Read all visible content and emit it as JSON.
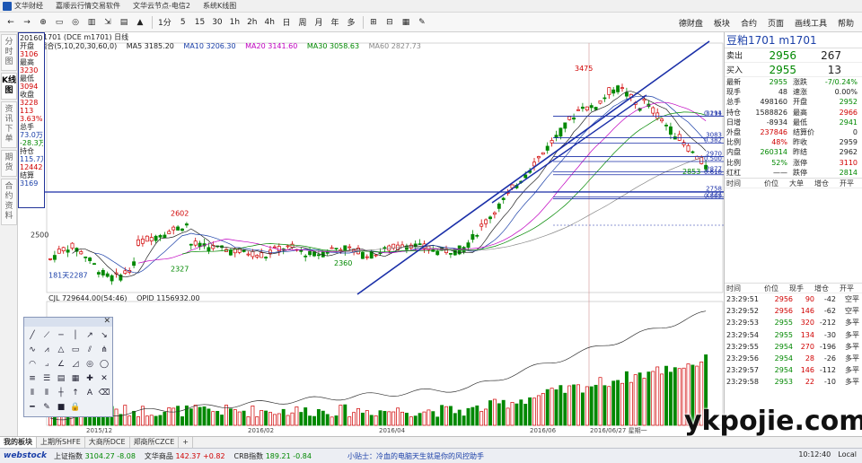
{
  "titlebar": {
    "items": [
      "文华财经",
      "嘉顺云行情交易软件",
      "文华云节点-电信2",
      "系统K线图"
    ],
    "right": [
      "德财盘",
      "板块",
      "合约",
      "页面",
      "画线工具",
      "帮助"
    ]
  },
  "toolbar": {
    "buttons": [
      "←",
      "→",
      "⊕",
      "▭",
      "◎",
      "▥",
      "⇲",
      "▤",
      "▲",
      "1分",
      "5",
      "15",
      "30",
      "1h",
      "2h",
      "4h",
      "日",
      "周",
      "月",
      "年",
      "多",
      "⊞",
      "⊟",
      "▦",
      "✎"
    ],
    "right_buttons": [
      "德财盘",
      "板块",
      "合约",
      "页面",
      "画线工具",
      "帮助"
    ]
  },
  "left_tabs": [
    "分时图",
    "K线图",
    "资讯下单",
    "期货",
    "合约资料"
  ],
  "data_window": {
    "date": "20160627",
    "rows": [
      {
        "label": "开盘",
        "value": "3106",
        "cls": "up"
      },
      {
        "label": "最高",
        "value": "3230",
        "cls": "up"
      },
      {
        "label": "最低",
        "value": "3094",
        "cls": "up"
      },
      {
        "label": "收盘",
        "value": "3228",
        "cls": "up"
      },
      {
        "label": "",
        "value": "113",
        "cls": "up"
      },
      {
        "label": "",
        "value": "3.63%",
        "cls": "up"
      },
      {
        "label": "总手",
        "value": "73.0万",
        "cls": "bl"
      },
      {
        "label": "",
        "value": "-28.3万",
        "cls": "dn"
      },
      {
        "label": "持仓",
        "value": "115.7万",
        "cls": "bl"
      },
      {
        "label": "",
        "value": "12442",
        "cls": "up"
      },
      {
        "label": "结算",
        "value": "3169",
        "cls": "bl"
      }
    ]
  },
  "chart_head": "豆粕1701 (DCE m1701) 日线",
  "ma_legend": [
    {
      "text": "MA组合(5,10,20,30,60,0)",
      "color": "#222222"
    },
    {
      "text": "MA5 3185.20",
      "color": "#222222"
    },
    {
      "text": "MA10 3206.30",
      "color": "#1a3fa8"
    },
    {
      "text": "MA20 3141.60",
      "color": "#c000c0"
    },
    {
      "text": "MA30 3058.63",
      "color": "#008800"
    },
    {
      "text": "MA60 2827.73",
      "color": "#888888"
    }
  ],
  "vol_legend": [
    "CJL 729644.00(54:46)",
    "OPID 1156932.00"
  ],
  "chart_data": {
    "type": "candlestick",
    "dates": [
      "2015/12",
      "2016/02",
      "2016/04",
      "2016/06",
      "2016/06/27 星期一"
    ],
    "price_ylim": [
      2150,
      3600
    ],
    "price_ticks": [
      2500
    ],
    "annotations": [
      {
        "label": "3475",
        "value": 3475
      },
      {
        "label": "2602",
        "value": 2602
      },
      {
        "label": "2327",
        "value": 2327
      },
      {
        "label": "2360",
        "value": 2360
      },
      {
        "label": "181天2287",
        "value": 2287
      },
      {
        "label": "2853",
        "value": 2853
      }
    ],
    "right_levels": [
      {
        "label": "3214",
        "value": 3214
      },
      {
        "label": "0.191",
        "value": 3214
      },
      {
        "label": "3083",
        "value": 3083
      },
      {
        "label": "0.382",
        "value": 3050
      },
      {
        "label": "2970",
        "value": 2970
      },
      {
        "label": "0.500",
        "value": 2940
      },
      {
        "label": "2877",
        "value": 2877
      },
      {
        "label": "0.618",
        "value": 2860
      },
      {
        "label": "2758",
        "value": 2758
      },
      {
        "label": "2727",
        "value": 2727
      },
      {
        "label": "0.809",
        "value": 2715
      }
    ],
    "volume_ylim": [
      0,
      1200000
    ]
  },
  "quote": {
    "title": "豆粕1701  m1701",
    "sell_label": "卖出",
    "sell_price": "2956",
    "sell_vol": "267",
    "buy_label": "买入",
    "buy_price": "2955",
    "buy_vol": "13",
    "rows": [
      {
        "l1": "最新",
        "v1": "2955",
        "c1": "grn",
        "l2": "涨跌",
        "v2": "-7/0.24%",
        "c2": "grn"
      },
      {
        "l1": "现手",
        "v1": "48",
        "c1": "blk",
        "l2": "速涨",
        "v2": "0.00%",
        "c2": "blk"
      },
      {
        "l1": "总手",
        "v1": "498160",
        "c1": "blk",
        "l2": "开盘",
        "v2": "2952",
        "c2": "grn"
      },
      {
        "l1": "持仓",
        "v1": "1588826",
        "c1": "blk",
        "l2": "最高",
        "v2": "2966",
        "c2": "red"
      },
      {
        "l1": "日增",
        "v1": "-8934",
        "c1": "blk",
        "l2": "最低",
        "v2": "2941",
        "c2": "grn"
      },
      {
        "l1": "外盘",
        "v1": "237846",
        "c1": "red",
        "l2": "结算价",
        "v2": "0",
        "c2": "blk"
      },
      {
        "l1": "比例",
        "v1": "48%",
        "c1": "red",
        "l2": "昨收",
        "v2": "2959",
        "c2": "blk"
      },
      {
        "l1": "内盘",
        "v1": "260314",
        "c1": "grn",
        "l2": "昨结",
        "v2": "2962",
        "c2": "blk"
      },
      {
        "l1": "比例",
        "v1": "52%",
        "c1": "grn",
        "l2": "涨停",
        "v2": "3110",
        "c2": "red"
      },
      {
        "l1": "红杠",
        "v1": "——",
        "c1": "blk",
        "l2": "跌停",
        "v2": "2814",
        "c2": "grn"
      }
    ],
    "sub_header": [
      "时间",
      "价位",
      "大单",
      "增仓",
      "开平"
    ],
    "tick_header": [
      "时间",
      "价位",
      "现手",
      "增仓",
      "开平"
    ],
    "ticks": [
      {
        "t": "23:29:51",
        "p": "2956",
        "q": "90",
        "d": "-42",
        "n": "空平",
        "pc": "red"
      },
      {
        "t": "23:29:52",
        "p": "2956",
        "q": "146",
        "d": "-62",
        "n": "空平",
        "pc": "red"
      },
      {
        "t": "23:29:53",
        "p": "2955",
        "q": "320",
        "d": "-212",
        "n": "多平",
        "pc": "grn"
      },
      {
        "t": "23:29:54",
        "p": "2955",
        "q": "134",
        "d": "-30",
        "n": "多平",
        "pc": "grn"
      },
      {
        "t": "23:29:55",
        "p": "2954",
        "q": "270",
        "d": "-196",
        "n": "多平",
        "pc": "grn"
      },
      {
        "t": "23:29:56",
        "p": "2954",
        "q": "28",
        "d": "-26",
        "n": "多平",
        "pc": "grn"
      },
      {
        "t": "23:29:57",
        "p": "2954",
        "q": "146",
        "d": "-112",
        "n": "多平",
        "pc": "grn"
      },
      {
        "t": "23:29:58",
        "p": "2953",
        "q": "22",
        "d": "-10",
        "n": "多平",
        "pc": "grn"
      }
    ]
  },
  "bottom_tabs": [
    "我的板块",
    "上期所SHFE",
    "大商所DCE",
    "郑商所CZCE",
    "+"
  ],
  "status": {
    "logo": "webstock",
    "indices": [
      {
        "name": "上证指数",
        "val": "3104.27",
        "chg": "-8.08",
        "cls": "grn"
      },
      {
        "name": "文华商品",
        "val": "142.37",
        "chg": "+0.82",
        "cls": "red"
      },
      {
        "name": "CRB指数",
        "val": "189.21",
        "chg": "-0.84",
        "cls": "grn"
      }
    ],
    "tip": "小贴士：冷血的电脑天生就是你的风控助手",
    "right": [
      "10:12:40",
      "Local"
    ]
  },
  "watermark": "ykpojie.com"
}
